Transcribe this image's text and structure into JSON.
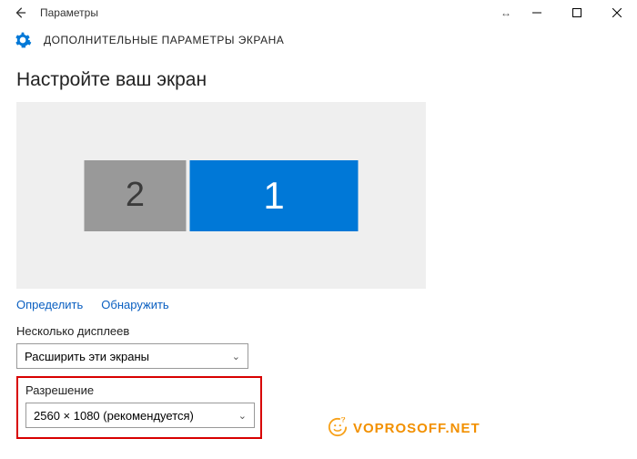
{
  "window": {
    "title": "Параметры"
  },
  "header": {
    "section_title": "ДОПОЛНИТЕЛЬНЫЕ ПАРАМЕТРЫ ЭКРАНА"
  },
  "main": {
    "heading": "Настройте ваш экран",
    "monitors": {
      "secondary_label": "2",
      "primary_label": "1"
    },
    "links": {
      "identify": "Определить",
      "detect": "Обнаружить"
    },
    "multi_displays": {
      "label": "Несколько дисплеев",
      "value": "Расширить эти экраны"
    },
    "resolution": {
      "label": "Разрешение",
      "value": "2560 × 1080 (рекомендуется)"
    }
  },
  "watermark": "VOPROSOFF.NET"
}
